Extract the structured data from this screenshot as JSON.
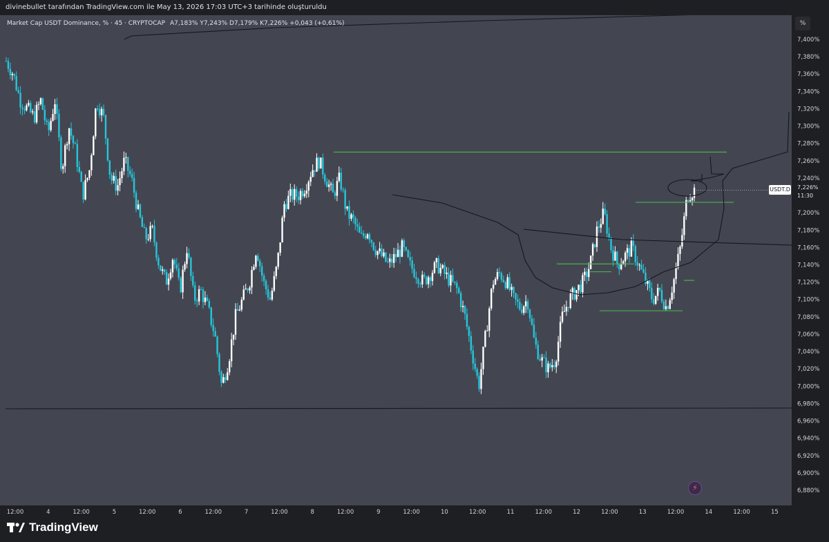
{
  "header": {
    "caption": "divinebullet tarafından TradingView.com ile May 13, 2026 17:03 UTC+3 tarihinde oluşturuldu"
  },
  "legend": {
    "title": "Market Cap USDT Dominance, % · 45 · CRYPTOCAP",
    "ohlc": "A7,183%  Y7,243%  D7,179%  K7,226%  +0,043 (+0,61%)"
  },
  "scale_button": "%",
  "symbol_tag": "USDT.D",
  "last_price": "7,226%",
  "countdown": "11:30",
  "footer": {
    "brand": "TradingView"
  },
  "colors": {
    "background": "#434651",
    "up": "#ffffff",
    "down": "#26c6da",
    "trendline": "#131722",
    "level": "#4caf50"
  },
  "icons": {
    "alert": "lightning-icon",
    "logo": "tradingview-logo-icon"
  },
  "chart_data": {
    "type": "candlestick",
    "ylim": [
      6.87,
      7.42
    ],
    "y_ticks": [
      "7,400%",
      "7,380%",
      "7,360%",
      "7,340%",
      "7,320%",
      "7,300%",
      "7,280%",
      "7,260%",
      "7,240%",
      "7,220%",
      "7,200%",
      "7,180%",
      "7,160%",
      "7,140%",
      "7,120%",
      "7,100%",
      "7,080%",
      "7,060%",
      "7,040%",
      "7,020%",
      "7,000%",
      "6,980%",
      "6,960%",
      "6,940%",
      "6,920%",
      "6,900%",
      "6,880%"
    ],
    "x_ticks": [
      "12:00",
      "4",
      "12:00",
      "5",
      "12:00",
      "6",
      "12:00",
      "7",
      "12:00",
      "8",
      "12:00",
      "9",
      "12:00",
      "10",
      "12:00",
      "11",
      "12:00",
      "12",
      "12:00",
      "13",
      "12:00",
      "14",
      "12:00",
      "15"
    ],
    "close_path": [
      7.375,
      7.36,
      7.33,
      7.32,
      7.31,
      7.33,
      7.29,
      7.33,
      7.25,
      7.3,
      7.27,
      7.22,
      7.25,
      7.33,
      7.31,
      7.24,
      7.23,
      7.26,
      7.24,
      7.2,
      7.17,
      7.18,
      7.14,
      7.12,
      7.15,
      7.11,
      7.16,
      7.1,
      7.11,
      7.09,
      7.06,
      7.0,
      7.03,
      7.08,
      7.1,
      7.12,
      7.16,
      7.12,
      7.1,
      7.14,
      7.21,
      7.22,
      7.22,
      7.23,
      7.25,
      7.26,
      7.24,
      7.22,
      7.24,
      7.2,
      7.19,
      7.17,
      7.18,
      7.16,
      7.15,
      7.14,
      7.15,
      7.16,
      7.14,
      7.13,
      7.12,
      7.13,
      7.14,
      7.13,
      7.12,
      7.11,
      7.08,
      7.04,
      7.0,
      7.06,
      7.12,
      7.13,
      7.12,
      7.1,
      7.09,
      7.1,
      7.05,
      7.03,
      7.02,
      7.03,
      7.08,
      7.1,
      7.11,
      7.12,
      7.14,
      7.18,
      7.2,
      7.16,
      7.14,
      7.15,
      7.16,
      7.14,
      7.12,
      7.1,
      7.11,
      7.09,
      7.12,
      7.16,
      7.22,
      7.226
    ],
    "annotations": [
      {
        "type": "hline",
        "label": "7,270 resistance"
      },
      {
        "type": "hline",
        "label": "6,973 support"
      }
    ]
  }
}
